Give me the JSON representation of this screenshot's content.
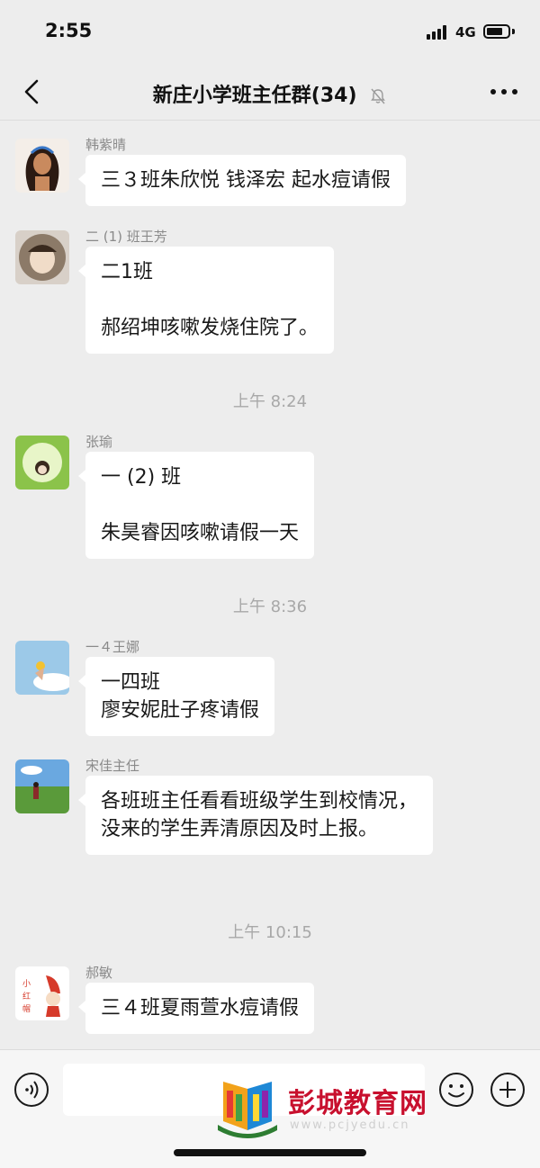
{
  "status": {
    "time": "2:55",
    "network": "4G"
  },
  "nav": {
    "title": "新庄小学班主任群(34)"
  },
  "messages": [
    {
      "sender": "韩紫晴",
      "text": "三３班朱欣悦 钱泽宏 起水痘请假"
    },
    {
      "sender": "二 (1) 班王芳",
      "text": "二1班\n\n郝绍坤咳嗽发烧住院了。"
    },
    {
      "sender": "张瑜",
      "text": "一 (2) 班\n\n朱昊睿因咳嗽请假一天"
    },
    {
      "sender": "一４王娜",
      "text": "一四班\n廖安妮肚子疼请假"
    },
    {
      "sender": "宋佳主任",
      "text": "各班班主任看看班级学生到校情况，没来的学生弄清原因及时上报。"
    },
    {
      "sender": "郝敏",
      "text": "三４班夏雨萱水痘请假"
    }
  ],
  "timestamps": [
    "上午 8:24",
    "上午 8:36",
    "上午 10:15"
  ],
  "watermark": {
    "text": "彭城教育网",
    "url": "www.pcjyedu.cn"
  },
  "colors": {
    "background": "#ededed",
    "bubble": "#ffffff",
    "sender": "#8a8a8a",
    "timestamp": "#a8a8a8",
    "watermark": "#c8102e"
  },
  "icons": [
    "back-icon",
    "mute-bell-icon",
    "more-icon",
    "voice-icon",
    "emoji-icon",
    "plus-icon"
  ]
}
